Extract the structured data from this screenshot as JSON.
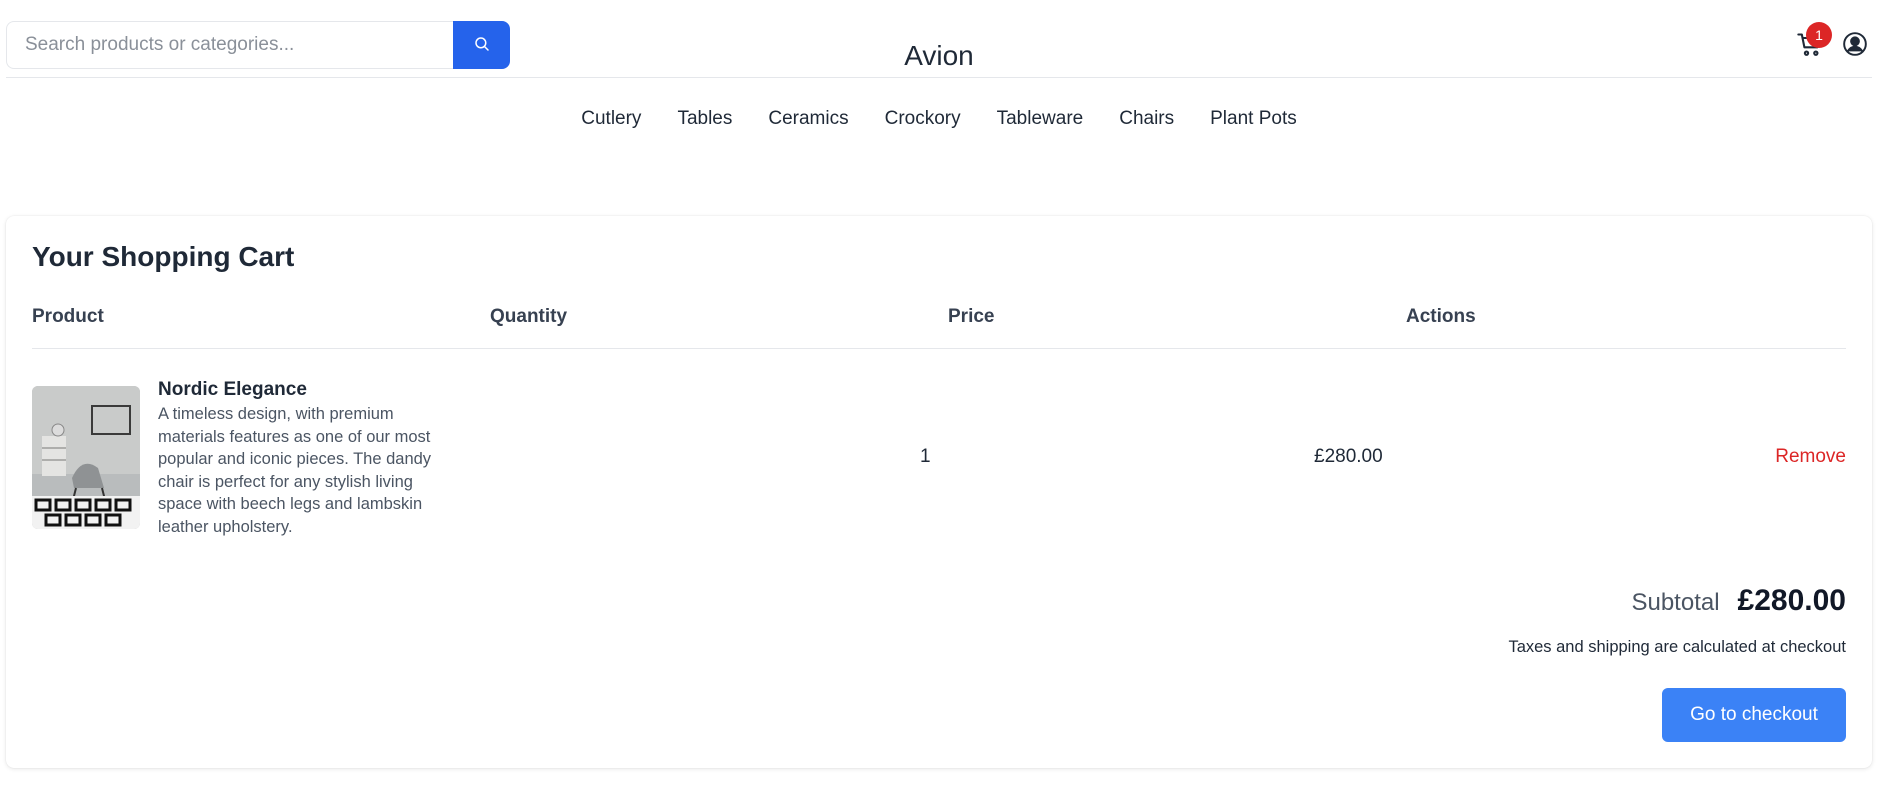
{
  "header": {
    "search_placeholder": "Search products or categories...",
    "search_icon": "search-icon",
    "brand": "Avion",
    "cart_icon": "cart-icon",
    "cart_count": "1",
    "user_icon": "user-circle-icon"
  },
  "nav": {
    "items": [
      "Cutlery",
      "Tables",
      "Ceramics",
      "Crockory",
      "Tableware",
      "Chairs",
      "Plant Pots"
    ]
  },
  "cart": {
    "title": "Your Shopping Cart",
    "columns": [
      "Product",
      "Quantity",
      "Price",
      "Actions"
    ],
    "items": [
      {
        "name": "Nordic Elegance",
        "description": "A timeless design, with premium materials features as one of our most popular and iconic pieces. The dandy chair is perfect for any stylish living space with beech legs and lambskin leather upholstery.",
        "quantity": "1",
        "price": "£280.00",
        "action": "Remove"
      }
    ],
    "subtotal_label": "Subtotal",
    "subtotal_value": "£280.00",
    "tax_note": "Taxes and shipping are calculated at checkout",
    "checkout_label": "Go to checkout"
  },
  "colors": {
    "primary": "#2563eb",
    "checkout": "#3b82f6",
    "danger": "#dc2626",
    "text": "#1f2937"
  }
}
